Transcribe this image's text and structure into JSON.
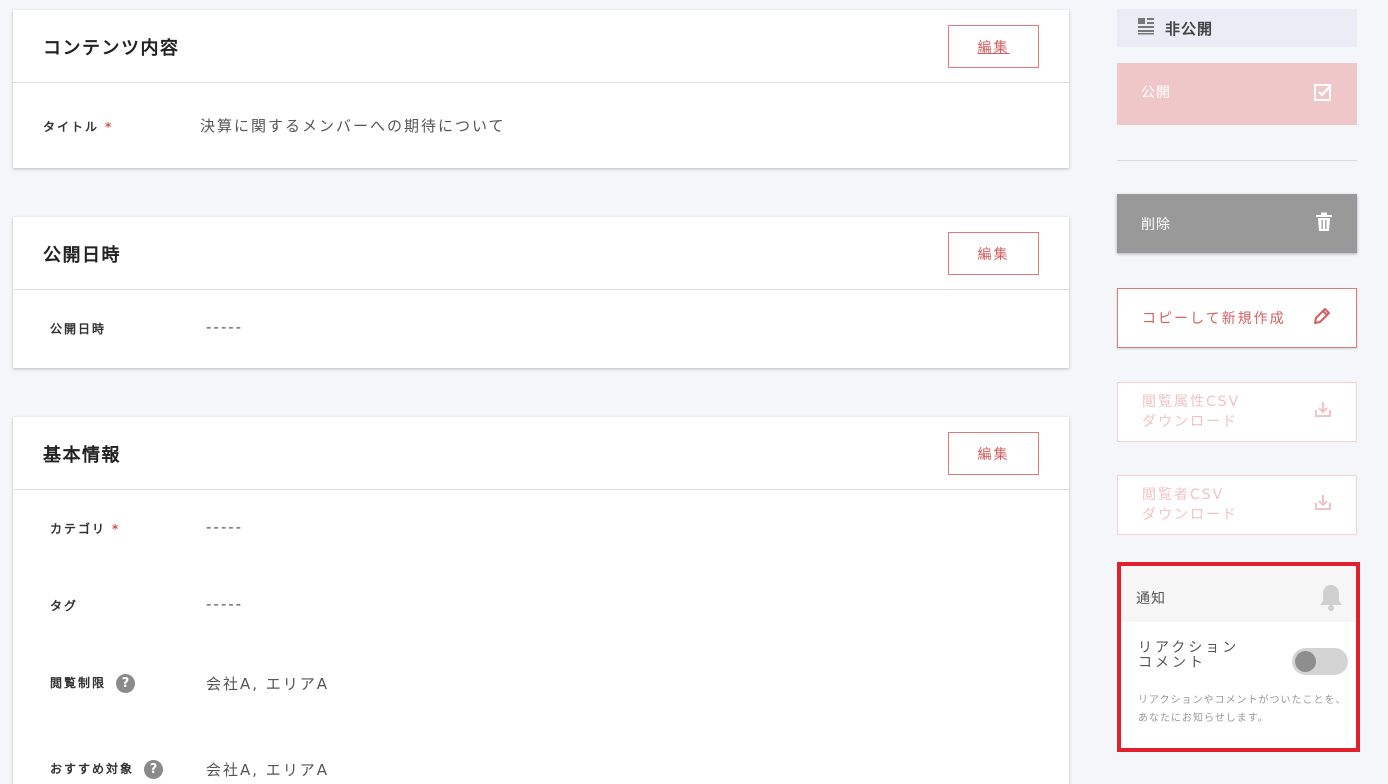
{
  "content_card": {
    "title": "コンテンツ内容",
    "edit_label": "編集",
    "rows": [
      {
        "label": "タイトル",
        "required_mark": "*",
        "value": "決算に関するメンバーへの期待について"
      }
    ]
  },
  "publish_card": {
    "title": "公開日時",
    "edit_label": "編集",
    "rows": [
      {
        "label": "公開日時",
        "value": "-----"
      }
    ]
  },
  "basic_card": {
    "title": "基本情報",
    "edit_label": "編集",
    "rows": [
      {
        "label": "カテゴリ",
        "required_mark": "*",
        "value": "-----"
      },
      {
        "label": "タグ",
        "value": "-----"
      },
      {
        "label": "閲覧制限",
        "help": "?",
        "value": "会社A, エリアA"
      },
      {
        "label": "おすすめ対象",
        "help": "?",
        "value": "会社A, エリアA"
      }
    ]
  },
  "sidebar": {
    "status": "非公開",
    "publish_label": "公開",
    "delete_label": "削除",
    "copy_label": "コピーして新規作成",
    "csv1_line1": "閲覧属性CSV",
    "csv1_line2": "ダウンロード",
    "csv2_line1": "閲覧者CSV",
    "csv2_line2": "ダウンロード",
    "notify": {
      "title": "通知",
      "row_line1": "リアクション",
      "row_line2": "コメント",
      "toggle_on": false,
      "description": "リアクションやコメントがついたことを、あなたにお知らせします。"
    }
  },
  "colors": {
    "accent": "#d45f5f",
    "highlight_border": "#e0202a"
  }
}
